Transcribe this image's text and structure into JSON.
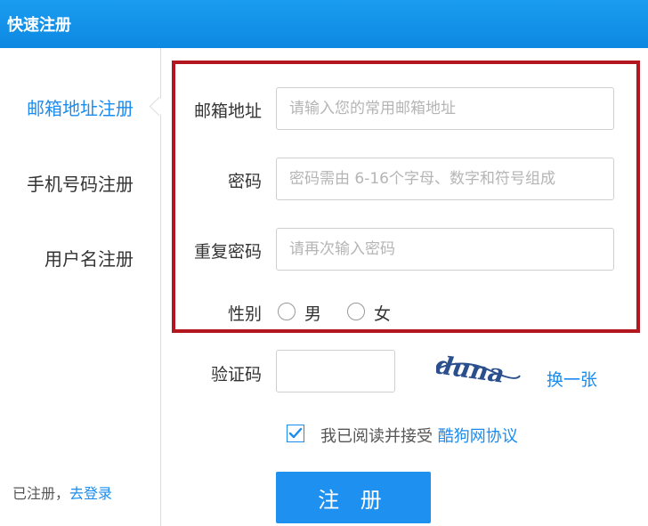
{
  "window": {
    "title": "快速注册"
  },
  "sidebar": {
    "items": [
      {
        "label": "邮箱地址注册",
        "active": true
      },
      {
        "label": "手机号码注册",
        "active": false
      },
      {
        "label": "用户名注册",
        "active": false
      }
    ],
    "login_prefix": "已注册，",
    "login_link": "去登录"
  },
  "form": {
    "email": {
      "label": "邮箱地址",
      "placeholder": "请输入您的常用邮箱地址",
      "value": ""
    },
    "password": {
      "label": "密码",
      "placeholder": "密码需由 6-16个字母、数字和符号组成",
      "value": ""
    },
    "confirm": {
      "label": "重复密码",
      "placeholder": "请再次输入密码",
      "value": ""
    },
    "gender": {
      "label": "性别",
      "options": [
        "男",
        "女"
      ]
    },
    "captcha": {
      "label": "验证码",
      "value": "",
      "image_text": "duna",
      "refresh": "换一张"
    },
    "agreement": {
      "text": "我已阅读并接受",
      "link": "酷狗网协议",
      "checked": true
    },
    "submit": "注 册"
  },
  "colors": {
    "accent": "#1a8cf0",
    "title_bar": "#0d88e2",
    "highlight": "#b2161e"
  }
}
